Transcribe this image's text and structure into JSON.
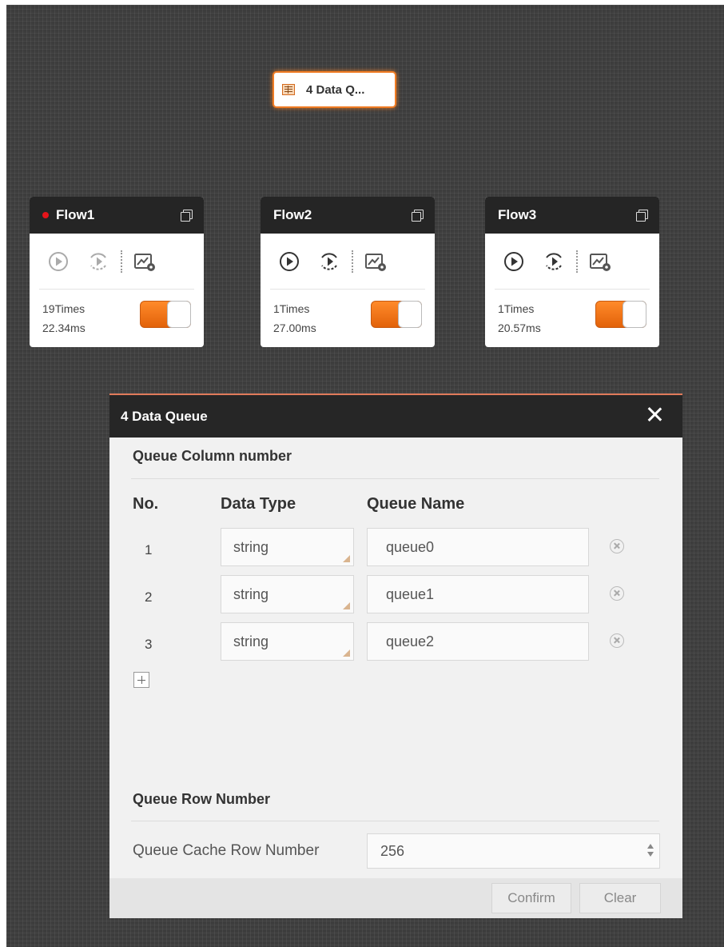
{
  "data_queue_node": {
    "label": "4 Data Q...",
    "icon": "queue-table-icon"
  },
  "flows": [
    {
      "name": "Flow1",
      "running_indicator": true,
      "times": "19Times",
      "duration": "22.34ms",
      "enabled": true
    },
    {
      "name": "Flow2",
      "running_indicator": false,
      "times": "1Times",
      "duration": "27.00ms",
      "enabled": true
    },
    {
      "name": "Flow3",
      "running_indicator": false,
      "times": "1Times",
      "duration": "20.57ms",
      "enabled": true
    }
  ],
  "dialog": {
    "title": "4 Data Queue",
    "section_column": "Queue Column number",
    "headers": {
      "no": "No.",
      "type": "Data Type",
      "name": "Queue Name"
    },
    "rows": [
      {
        "no": "1",
        "type": "string",
        "name": "queue0"
      },
      {
        "no": "2",
        "type": "string",
        "name": "queue1"
      },
      {
        "no": "3",
        "type": "string",
        "name": "queue2"
      }
    ],
    "section_row": "Queue Row Number",
    "cache_label": "Queue Cache Row Number",
    "cache_value": "256",
    "confirm_label": "Confirm",
    "clear_label": "Clear"
  },
  "colors": {
    "accent": "#f07c24",
    "toggle_on": "#e8680f",
    "indicator": "#e5141a",
    "canvas": "#3d3d3d"
  }
}
